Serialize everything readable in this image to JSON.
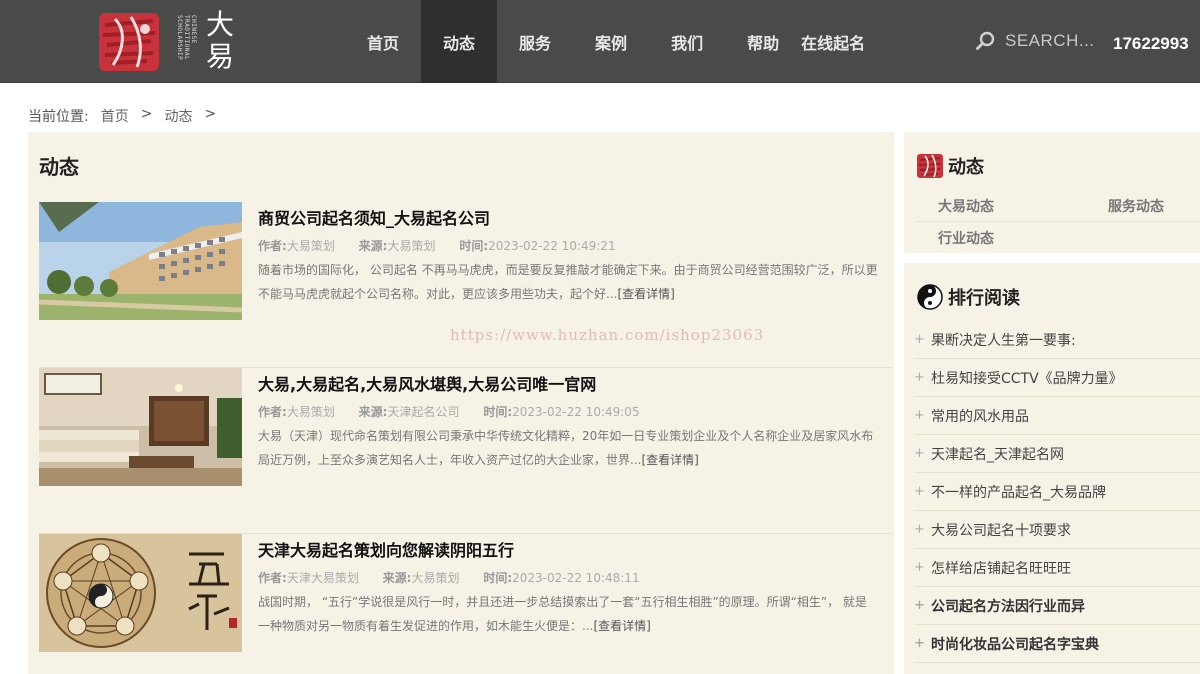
{
  "header": {
    "logo_text": "大易",
    "logo_vertical": "CHINESE TRADITIONAL SCHOLARSHIP",
    "nav": [
      {
        "label": "首页"
      },
      {
        "label": "动态"
      },
      {
        "label": "服务"
      },
      {
        "label": "案例"
      },
      {
        "label": "我们"
      },
      {
        "label": "帮助"
      },
      {
        "label": "在线起名"
      }
    ],
    "active_nav": "动态",
    "search_placeholder": "SEARCH...",
    "phone": "17622993"
  },
  "breadcrumb": {
    "label": "当前位置:",
    "items": [
      "首页",
      "动态"
    ],
    "separator": ">"
  },
  "main": {
    "title": "动态",
    "articles": [
      {
        "title": "商贸公司起名须知_大易起名公司",
        "author_label": "作者:",
        "author": "大易策划",
        "source_label": "来源:",
        "source": "大易策划",
        "time_label": "时间:",
        "time": "2023-02-22 10:49:21",
        "desc": "随着市场的国际化， 公司起名 不再马马虎虎，而是要反复推敲才能确定下来。由于商贸公司经营范围较广泛，所以更不能马马虎虎就起个公司名称。对此，更应该多用些功夫，起个好...",
        "more": "[查看详情]"
      },
      {
        "title": "大易,大易起名,大易风水堪舆,大易公司唯一官网",
        "author_label": "作者:",
        "author": "大易策划",
        "source_label": "来源:",
        "source": "天津起名公司",
        "time_label": "时间:",
        "time": "2023-02-22 10:49:05",
        "desc": "大易（天津）现代命名策划有限公司秉承中华传统文化精粹，20年如一日专业策划企业及个人名称企业及居家风水布局近万例，上至众多演艺知名人士，年收入资产过亿的大企业家，世界...",
        "more": "[查看详情]"
      },
      {
        "title": "天津大易起名策划向您解读阴阳五行",
        "author_label": "作者:",
        "author": "天津大易策划",
        "source_label": "来源:",
        "source": "大易策划",
        "time_label": "时间:",
        "time": "2023-02-22 10:48:11",
        "desc": "战国时期， “五行”学说很是风行一时，并且还进一步总结摸索出了一套“五行相生相胜”的原理。所谓“相生”， 就是一种物质对另一物质有着生发促进的作用，如木能生火便是：...",
        "more": "[查看详情]"
      }
    ]
  },
  "watermark": "https://www.huzhan.com/ishop23063",
  "sidebar": {
    "news": {
      "title": "动态",
      "categories": [
        "大易动态",
        "服务动态",
        "行业动态"
      ]
    },
    "ranking": {
      "title": "排行阅读",
      "items": [
        "果断决定人生第一要事:",
        "杜易知接受CCTV《品牌力量》",
        "常用的风水用品",
        "天津起名_天津起名网",
        "不一样的产品起名_大易品牌",
        "大易公司起名十项要求",
        "怎样给店铺起名旺旺旺",
        "公司起名方法因行业而异",
        "时尚化妆品公司起名字宝典"
      ]
    }
  },
  "colors": {
    "header_bg": "#4a4a4a",
    "nav_active_bg": "#2f2f2f",
    "panel_bg": "#f6f3e6",
    "brand_red": "#c8323a"
  }
}
